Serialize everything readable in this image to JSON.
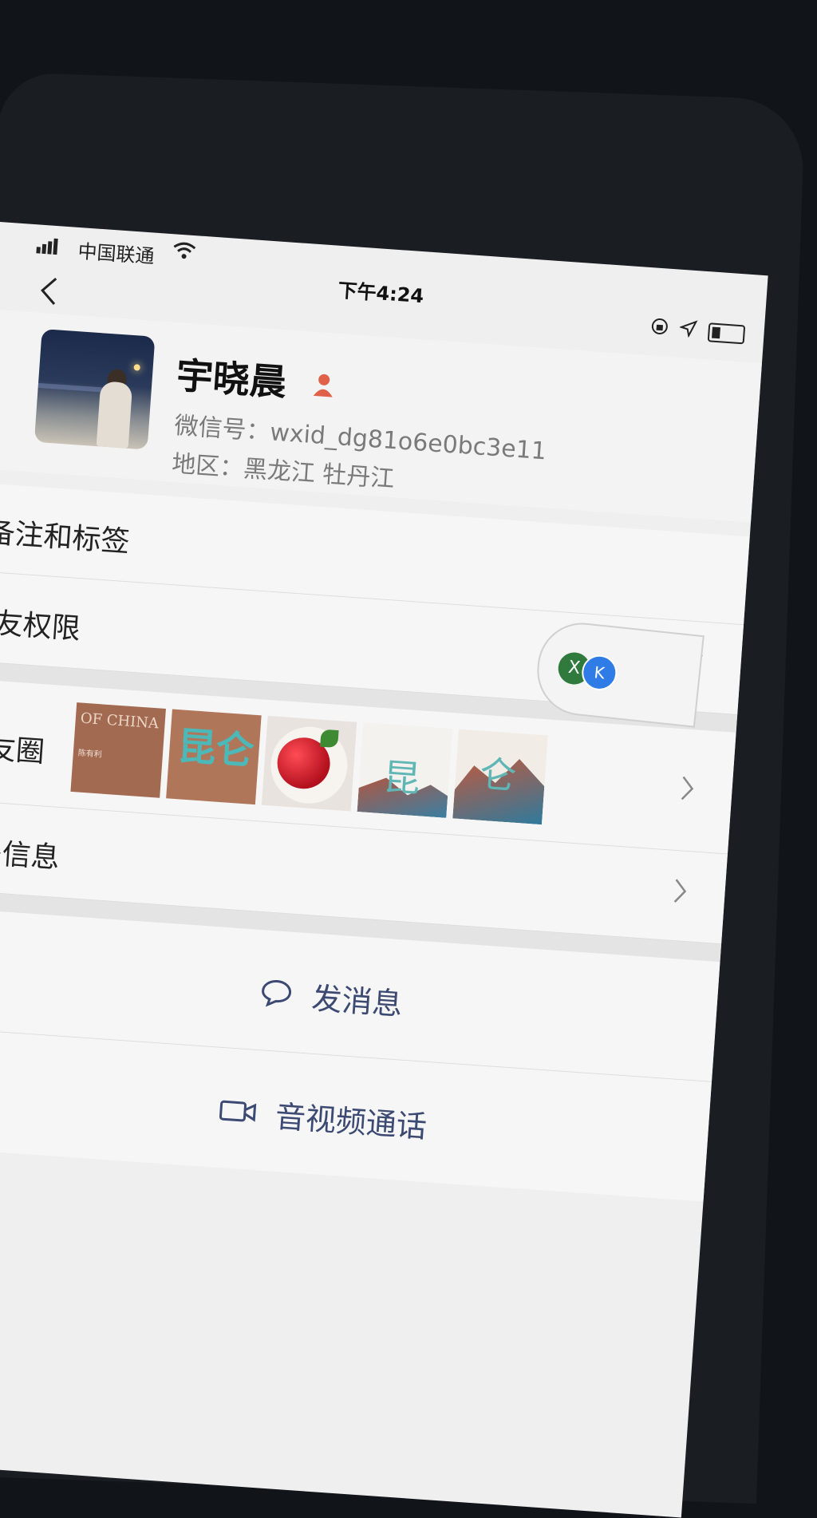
{
  "status_bar": {
    "carrier": "中国联通",
    "time": "下午4:24"
  },
  "profile": {
    "name": "宇晓晨",
    "wechat_id": "微信号：wxid_dg81o6e0bc3e11",
    "region": "地区：黑龙江 牡丹江"
  },
  "menu": {
    "remark_tags": "备注和标签",
    "friend_permissions": "朋友权限",
    "moments": "朋友圈",
    "more_info": "更多信息"
  },
  "moments_thumbnails": [
    {
      "title": "OF CHINA",
      "subtitle": "陈有利"
    },
    {
      "title": "昆仑",
      "subtitle": ""
    },
    {
      "title": "",
      "subtitle": ""
    },
    {
      "title": "昆",
      "subtitle": ""
    },
    {
      "title": "仑",
      "subtitle": ""
    }
  ],
  "actions": {
    "send_message": "发消息",
    "av_call": "音视频通话"
  },
  "floating": {
    "x_label": "X",
    "app_label": "K"
  },
  "colors": {
    "action_text": "#3c4a73",
    "gender_icon": "#e0614a"
  }
}
